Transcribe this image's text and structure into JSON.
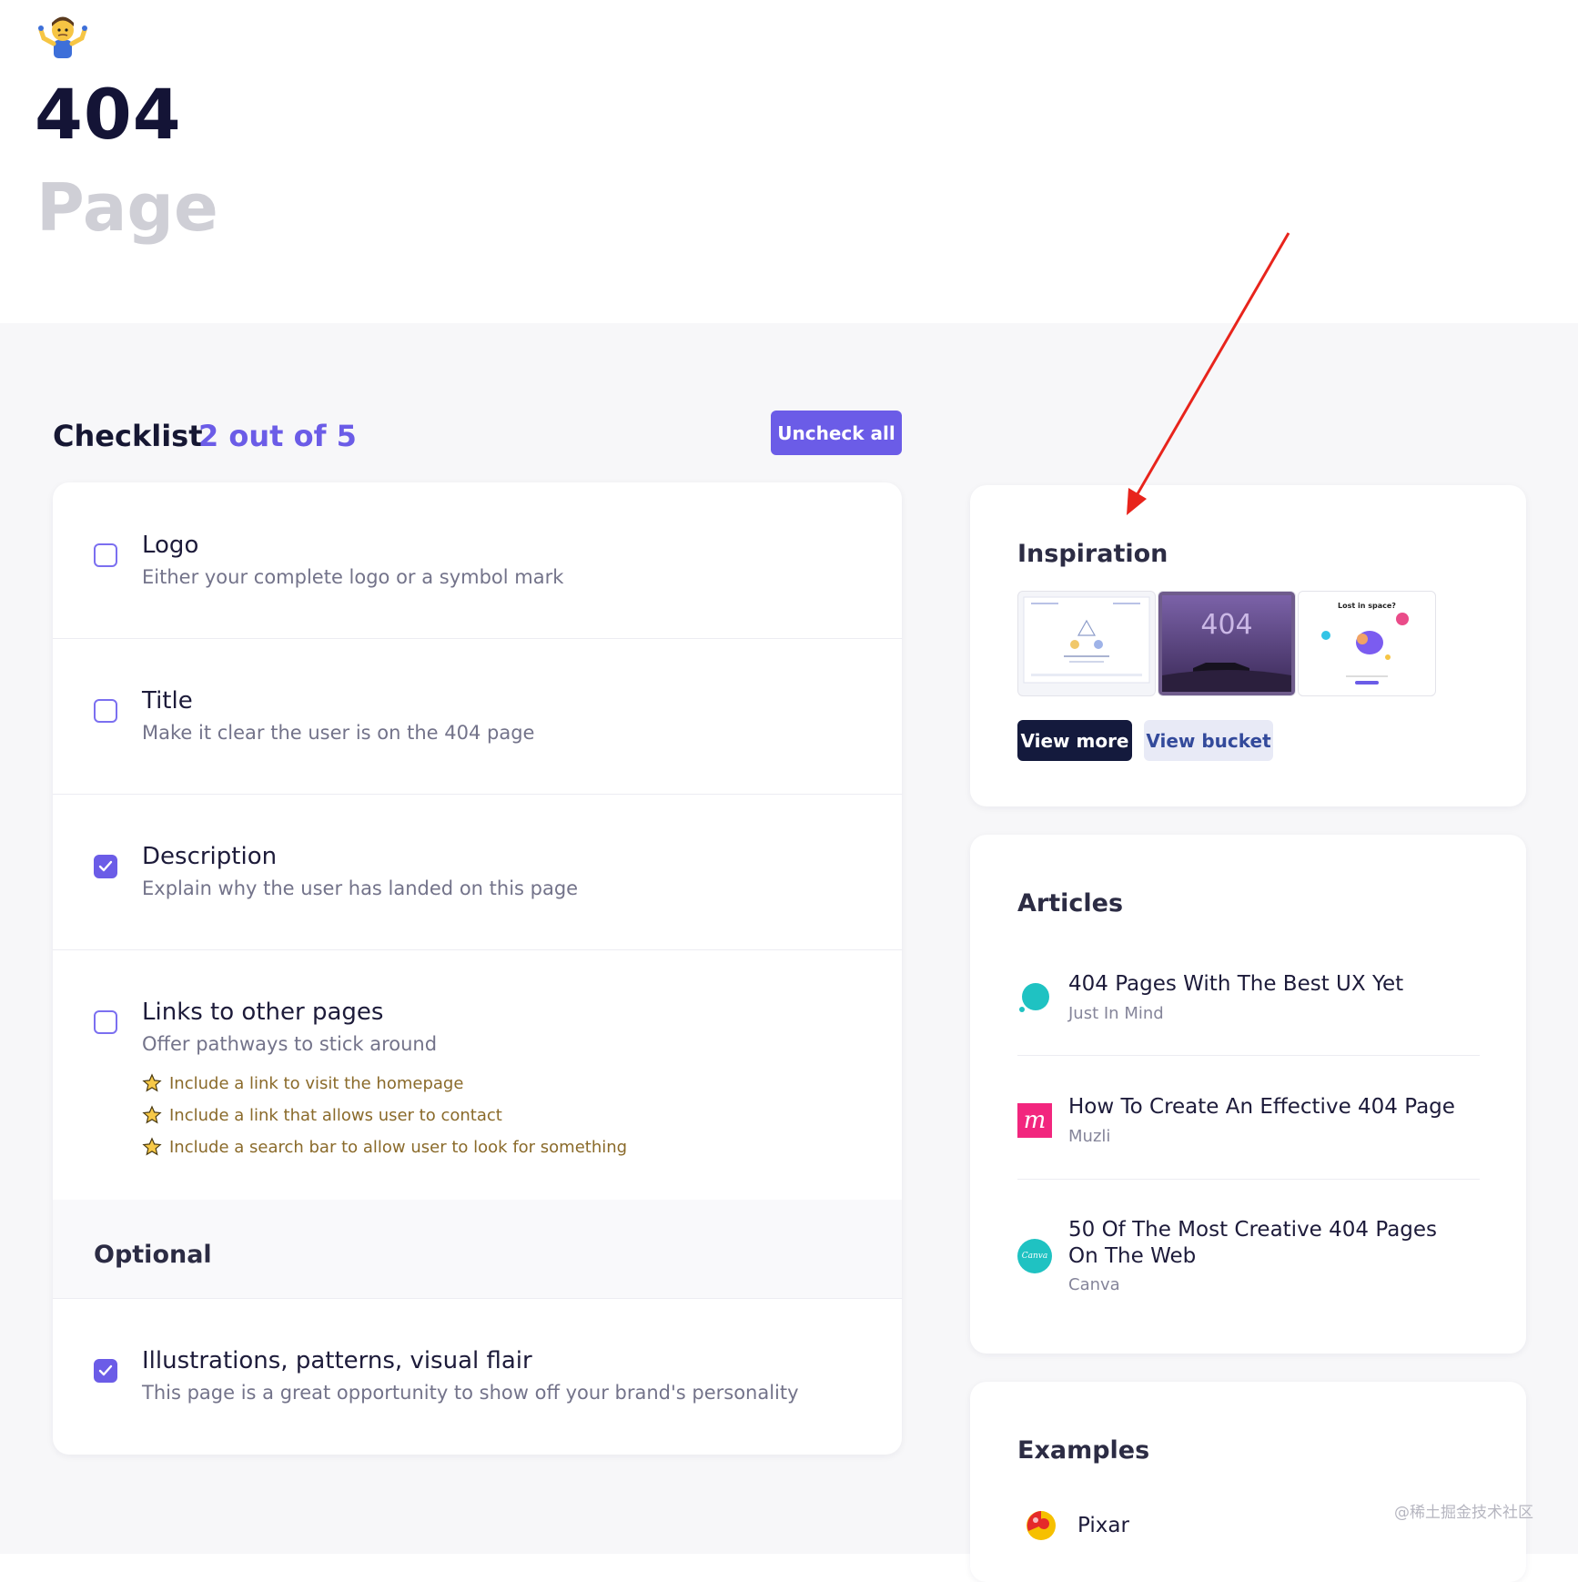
{
  "hero": {
    "emoji": "person-shrugging",
    "title": "404",
    "subtitle": "Page"
  },
  "checklist": {
    "heading": "Checklist",
    "count": "2 out of 5",
    "uncheck_label": "Uncheck all",
    "items": [
      {
        "title": "Logo",
        "desc": "Either your complete logo or a symbol mark",
        "checked": false
      },
      {
        "title": "Title",
        "desc": "Make it clear the user is on the 404 page",
        "checked": false
      },
      {
        "title": "Description",
        "desc": "Explain why the user has landed on this page",
        "checked": true
      },
      {
        "title": "Links to other pages",
        "desc": "Offer pathways to stick around",
        "checked": false,
        "tips": [
          "Include a link to visit the homepage",
          "Include a link that allows user to contact",
          "Include a search bar to allow user to look for something"
        ]
      }
    ],
    "optional_label": "Optional",
    "optional_items": [
      {
        "title": "Illustrations, patterns, visual flair",
        "desc": "This page is a great opportunity to show off your brand's personality",
        "checked": true
      }
    ]
  },
  "inspiration": {
    "title": "Inspiration",
    "thumb2_text": "404",
    "thumb3_text": "Lost in space?",
    "view_more": "View more",
    "view_bucket": "View bucket"
  },
  "articles": {
    "title": "Articles",
    "items": [
      {
        "title": "404 Pages With The Best UX Yet",
        "source": "Just In Mind"
      },
      {
        "title": "How To Create An Effective 404 Page",
        "source": "Muzli"
      },
      {
        "title": "50 Of The Most Creative 404 Pages On The Web",
        "source": "Canva"
      }
    ],
    "logo_letters": {
      "muzli": "m",
      "canva": "Canva"
    }
  },
  "examples": {
    "title": "Examples",
    "items": [
      {
        "name": "Pixar"
      }
    ]
  },
  "watermark": "@稀土掘金技术社区",
  "colors": {
    "accent": "#6b5ce7",
    "dark": "#141a3d",
    "annotation": "#e8241c"
  }
}
